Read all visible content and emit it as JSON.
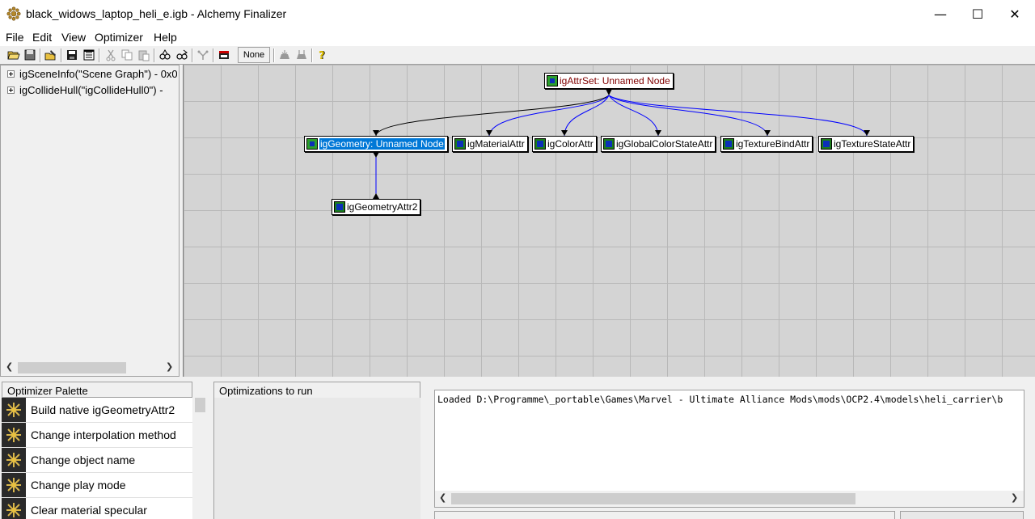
{
  "window": {
    "title": "black_widows_laptop_heli_e.igb - Alchemy Finalizer",
    "minimize": "—",
    "maximize": "☐",
    "close": "✕"
  },
  "menu": [
    "File",
    "Edit",
    "View",
    "Optimizer",
    "Help"
  ],
  "toolbar": {
    "none_label": "None",
    "icons": [
      "open-icon",
      "save-icon",
      "edit-icon",
      "save-disk-icon",
      "properties-icon",
      "cut-icon",
      "copy-icon",
      "paste-icon",
      "find-icon",
      "find-next-icon",
      "optimize-icon",
      "film-icon",
      "run-icon",
      "run-all-icon",
      "help-icon"
    ]
  },
  "tree": {
    "items": [
      "igSceneInfo(\"Scene Graph\") - 0x0",
      "igCollideHull(\"igCollideHull0\") -"
    ]
  },
  "graph": {
    "nodes": [
      {
        "id": "root",
        "label": "igAttrSet: Unnamed Node",
        "icon": "green"
      },
      {
        "id": "geom",
        "label": "igGeometry: Unnamed Node",
        "icon": "green"
      },
      {
        "id": "mat",
        "label": "igMaterialAttr",
        "icon": "blue"
      },
      {
        "id": "color",
        "label": "igColorAttr",
        "icon": "blue"
      },
      {
        "id": "gcs",
        "label": "igGlobalColorStateAttr",
        "icon": "blue"
      },
      {
        "id": "texbind",
        "label": "igTextureBindAttr",
        "icon": "blue"
      },
      {
        "id": "texstate",
        "label": "igTextureStateAttr",
        "icon": "blue"
      },
      {
        "id": "geomattr",
        "label": "igGeometryAttr2",
        "icon": "blue"
      }
    ],
    "edge_color_black": "#000000",
    "edge_color_blue": "#0000ff"
  },
  "palette": {
    "header": "Optimizer Palette",
    "items": [
      "Build native igGeometryAttr2",
      "Change interpolation method",
      "Change object name",
      "Change play mode",
      "Clear material specular"
    ]
  },
  "torun": {
    "header": "Optimizations to run"
  },
  "log": {
    "text": "Loaded D:\\Programme\\_portable\\Games\\Marvel - Ultimate Alliance Mods\\mods\\OCP2.4\\models\\heli_carrier\\b"
  }
}
